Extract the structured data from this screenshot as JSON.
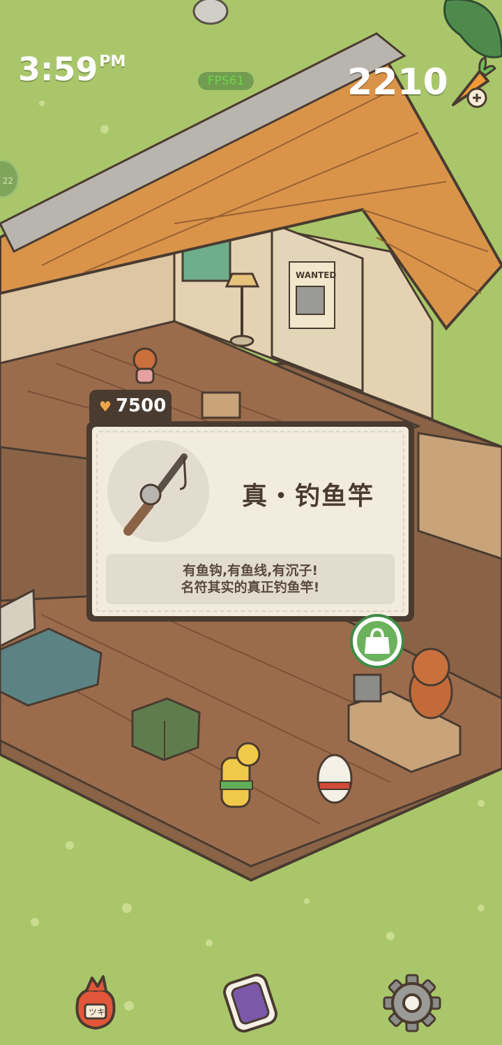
{
  "hud": {
    "time": "3:59",
    "ampm": "PM",
    "fps": "FPS61",
    "carrot_count": "2210",
    "side_badge": "22"
  },
  "item_popup": {
    "price_symbol": "♥",
    "price": "7500",
    "name": "真・钓鱼竿",
    "description_line1": "有鱼钩,有鱼线,有沉子!",
    "description_line2": "名符其实的真正钓鱼竿!"
  },
  "scene": {
    "poster_text": "WANTED",
    "bag_label": "ツキ"
  },
  "icons": {
    "carrot_add": "carrot-plus-icon",
    "shop": "shopping-bag-icon",
    "bag": "bag-icon",
    "phone": "phone-icon",
    "settings": "gear-icon",
    "fishing_rod": "fishing-rod-icon"
  },
  "colors": {
    "grass": "#a9c76a",
    "card_border": "#4a3b30",
    "card_bg": "#f2ecde",
    "price_symbol": "#f2a44a",
    "shop_green": "#3f8a45"
  }
}
